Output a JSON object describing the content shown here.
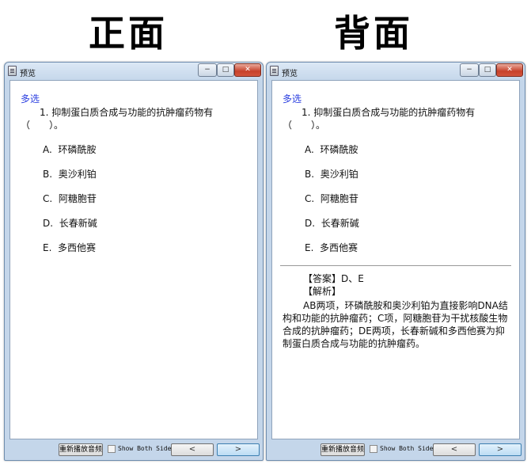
{
  "headings": {
    "front": "正面",
    "back": "背面"
  },
  "window": {
    "title": "预览",
    "min_glyph": "−",
    "max_glyph": "□",
    "close_glyph": "✕"
  },
  "question": {
    "type_label": "多选",
    "stem": "1. 抑制蛋白质合成与功能的抗肿瘤药物有（　　）。",
    "options": [
      {
        "letter": "A.",
        "text": "环磷酰胺"
      },
      {
        "letter": "B.",
        "text": "奥沙利铂"
      },
      {
        "letter": "C.",
        "text": "阿糖胞苷"
      },
      {
        "letter": "D.",
        "text": "长春新碱"
      },
      {
        "letter": "E.",
        "text": "多西他赛"
      }
    ]
  },
  "answer": {
    "line": "【答案】D、E",
    "analysis_title": "【解析】",
    "analysis_body": "AB两项，环磷酰胺和奥沙利铂为直接影响DNA结构和功能的抗肿瘤药；C项，阿糖胞苷为干扰核酸生物合成的抗肿瘤药；DE两项，长春新碱和多西他赛为抑制蛋白质合成与功能的抗肿瘤药。"
  },
  "toolbar": {
    "replay_label": "重新播放音频",
    "show_both_label": "Show Both Sides",
    "show_both_checked": false,
    "prev_label": "<",
    "next_label": ">"
  },
  "colors": {
    "type_label": "#2a3ee0",
    "close_button": "#c7412b",
    "window_frame": "#c4d6ea"
  }
}
